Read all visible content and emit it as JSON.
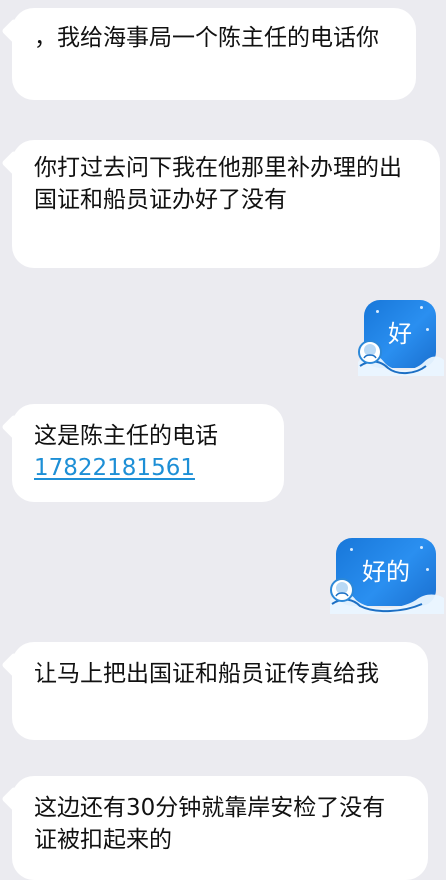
{
  "messages": [
    {
      "side": "in",
      "text": "，我给海事局一个陈主任的电话你"
    },
    {
      "side": "in",
      "text": "你打过去问下我在他那里补办理的出国证和船员证办好了没有"
    },
    {
      "side": "out",
      "text": "好"
    },
    {
      "side": "in",
      "text": "这是陈主任的电话",
      "phone": "17822181561"
    },
    {
      "side": "out",
      "text": "好的"
    },
    {
      "side": "in",
      "text": "让马上把出国证和船员证传真给我"
    },
    {
      "side": "in",
      "text": "这边还有30分钟就靠岸安检了没有证被扣起来的"
    }
  ],
  "colors": {
    "background": "#ebebf0",
    "incoming_bubble": "#ffffff",
    "outgoing_bubble": "#2a8ff0",
    "link": "#1d8fd6"
  },
  "icons": {
    "bubble_decoration": "wave-avatar-icon"
  }
}
